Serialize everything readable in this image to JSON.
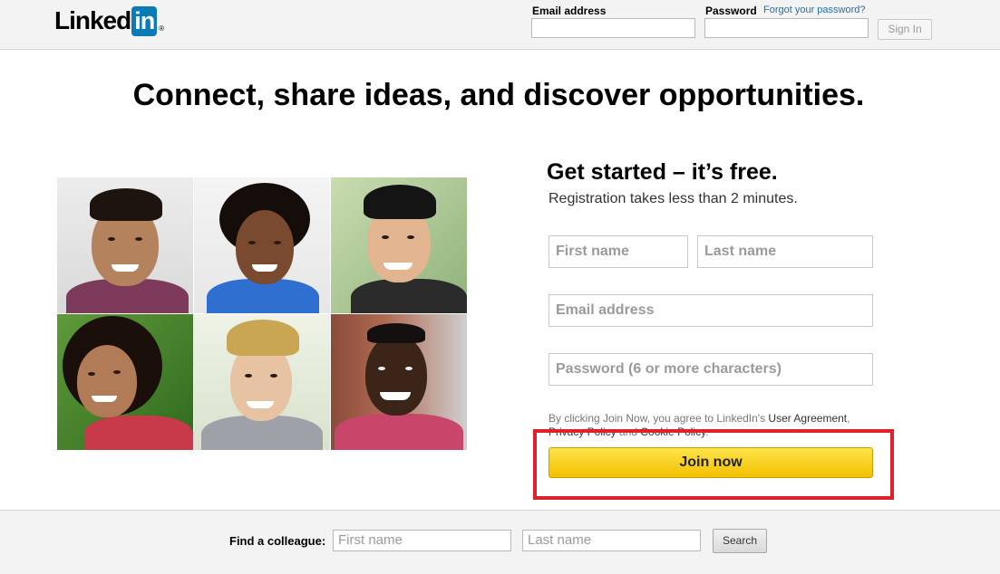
{
  "header": {
    "logo_text": "Linked",
    "logo_box": "in",
    "logo_reg": "®",
    "email_label": "Email address",
    "password_label": "Password",
    "forgot_link": "Forgot your password?",
    "signin_label": "Sign In"
  },
  "main": {
    "headline": "Connect, share ideas, and discover opportunities.",
    "photos": [
      "member-photo",
      "member-photo",
      "member-photo",
      "member-photo",
      "member-photo",
      "member-photo"
    ]
  },
  "form": {
    "title": "Get started – it’s free.",
    "subtitle": "Registration takes less than 2 minutes.",
    "first_name_placeholder": "First name",
    "last_name_placeholder": "Last name",
    "email_placeholder": "Email address",
    "password_placeholder": "Password (6 or more characters)",
    "agree_prefix": "By clicking Join Now, you agree to LinkedIn's ",
    "user_agreement": "User Agreement",
    "agree_comma": ",",
    "privacy_policy": "Privacy Policy",
    "agree_and": " and ",
    "cookie_policy": "Cookie Policy",
    "agree_end": ".",
    "join_label": "Join now"
  },
  "footer": {
    "find_label": "Find a colleague:",
    "first_name_placeholder": "First name",
    "last_name_placeholder": "Last name",
    "search_label": "Search"
  },
  "colors": {
    "brand_blue": "#0a7bb6",
    "join_yellow": "#f9d21c",
    "highlight_red": "#e0212b"
  }
}
